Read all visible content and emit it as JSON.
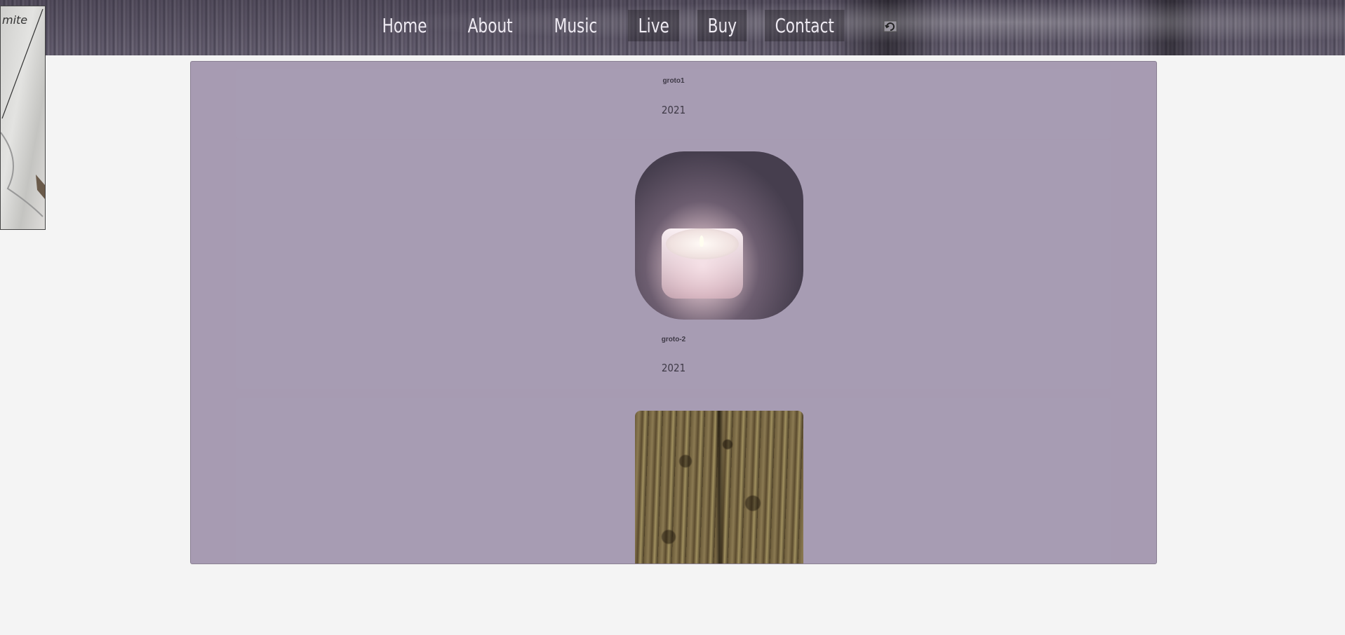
{
  "nav": {
    "items": [
      "Home",
      "About",
      "Music",
      "Live",
      "Buy",
      "Contact"
    ],
    "extra_icon": "refresh-icon"
  },
  "side_thumbnail": {
    "text": "mite"
  },
  "releases": [
    {
      "title": "groto1",
      "year": "2021",
      "cover": "candle-cover-image"
    },
    {
      "title": "groto-2",
      "year": "2021",
      "cover": "wood-bark-cover-image"
    }
  ],
  "colors": {
    "page_bg": "#f4f4f4",
    "panel_bg": "#a79bb2",
    "nav_text": "#eeeaf2",
    "item_text": "#3e3946"
  }
}
